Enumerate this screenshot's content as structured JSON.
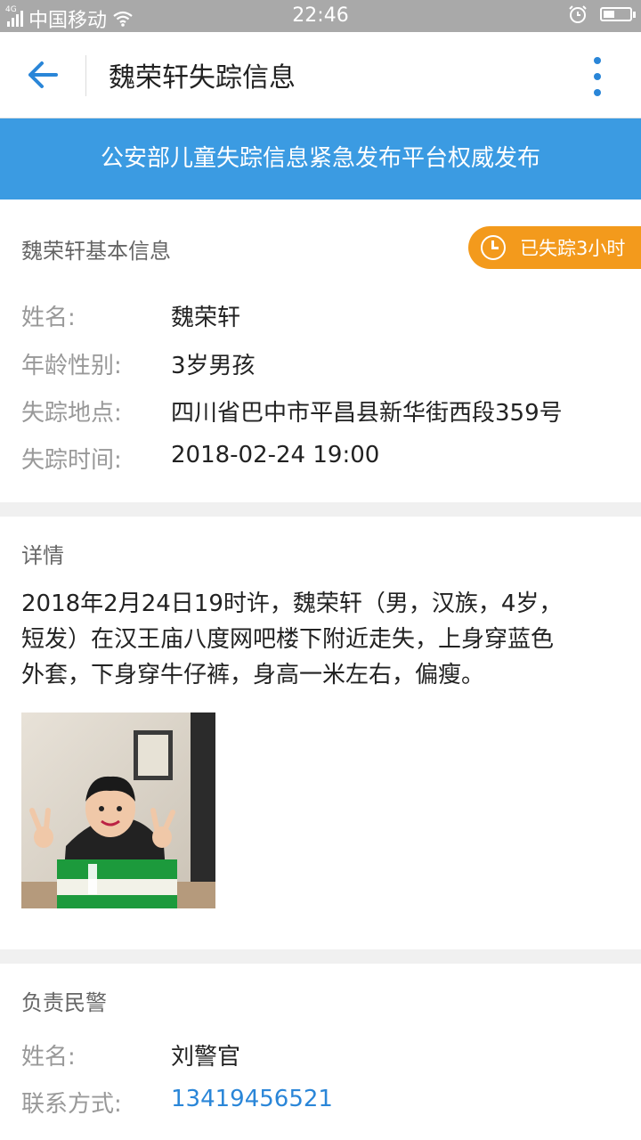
{
  "status_bar": {
    "network": "4G",
    "carrier": "中国移动",
    "time": "22:46"
  },
  "app_bar": {
    "title": "魏荣轩失踪信息",
    "back_icon": "arrow-left-icon",
    "more_icon": "more-vertical-icon"
  },
  "banner": {
    "text": "公安部儿童失踪信息紧急发布平台权威发布"
  },
  "basic_info": {
    "header": "魏荣轩基本信息",
    "badge_text": "已失踪3小时",
    "rows": [
      {
        "label": "姓名:",
        "value": "魏荣轩"
      },
      {
        "label": "年龄性别:",
        "value": "3岁男孩"
      },
      {
        "label": "失踪地点:",
        "value": "四川省巴中市平昌县新华街西段359号"
      },
      {
        "label": "失踪时间:",
        "value": "2018-02-24 19:00"
      }
    ]
  },
  "details": {
    "header": "详情",
    "lines": [
      "2018年2月24日19时许，魏荣轩（男，汉族，4岁，",
      "短发）在汉王庙八度网吧楼下附近走失，上身穿蓝色",
      "外套，下身穿牛仔裤，身高一米左右，偏瘦。"
    ]
  },
  "officer": {
    "header": "负责民警",
    "rows": [
      {
        "label": "姓名:",
        "value": "刘警官"
      },
      {
        "label": "联系方式:",
        "value": "13419456521"
      }
    ]
  },
  "colors": {
    "accent": "#3b9be2",
    "badge": "#f39a1c",
    "link": "#2a86d8"
  }
}
